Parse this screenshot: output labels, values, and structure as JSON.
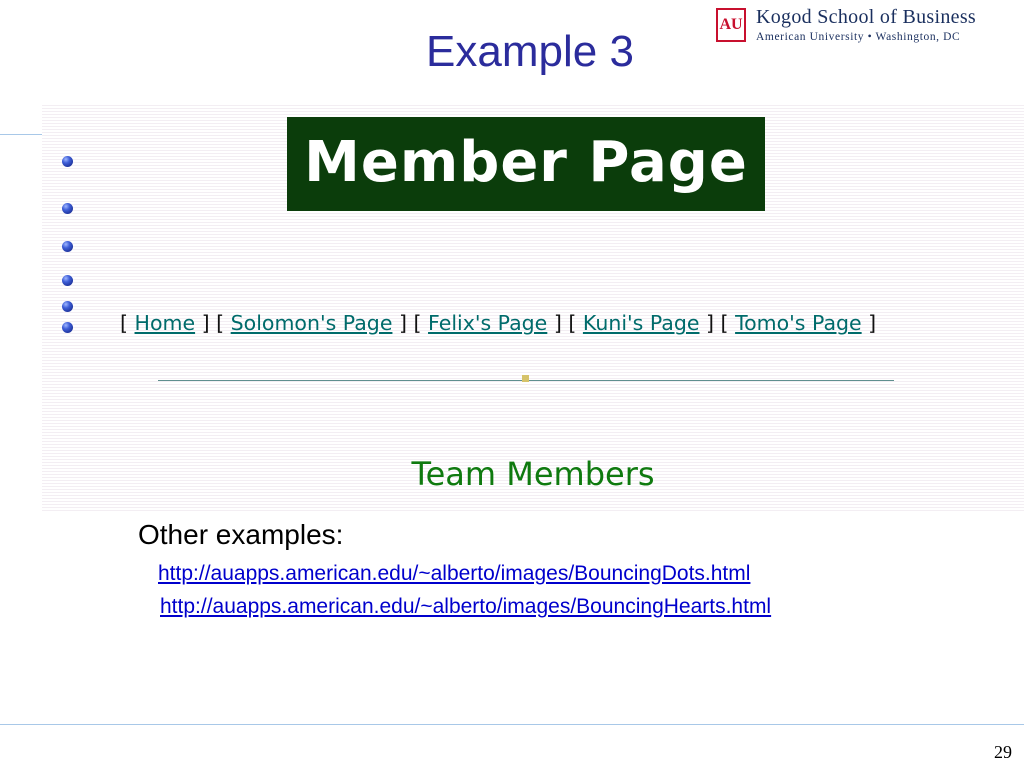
{
  "slide": {
    "title": "Example 3",
    "page_number": "29"
  },
  "logo": {
    "mark": "AU",
    "line1": "Kogod School of Business",
    "line2": "American University • Washington, DC"
  },
  "screenshot": {
    "banner": "Member Page",
    "nav": {
      "open": "[",
      "close": "]",
      "items": [
        "Home",
        "Solomon's Page",
        "Felix's Page",
        "Kuni's Page",
        "Tomo's Page"
      ]
    },
    "heading": "Team Members"
  },
  "examples": {
    "label": "Other examples:",
    "links": [
      "http://auapps.american.edu/~alberto/images/BouncingDots.html",
      "http://auapps.american.edu/~alberto/images/BouncingHearts.html"
    ]
  },
  "colors": {
    "title": "#2b2c9c",
    "banner_bg": "#0b3d0b",
    "nav_link": "#006b6b",
    "heading": "#0f7a0f",
    "url": "#0000cc",
    "brand_red": "#c8102e"
  }
}
